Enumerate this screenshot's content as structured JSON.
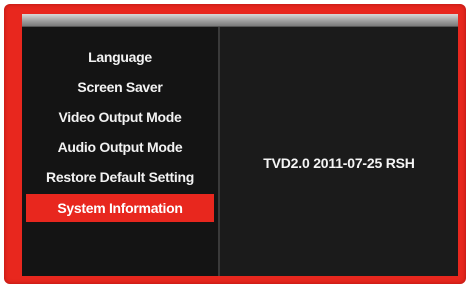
{
  "menu": {
    "items": [
      {
        "label": "Language"
      },
      {
        "label": "Screen Saver"
      },
      {
        "label": "Video Output Mode"
      },
      {
        "label": "Audio Output Mode"
      },
      {
        "label": "Restore Default Setting"
      },
      {
        "label": "System Information",
        "selected": true
      }
    ]
  },
  "info": {
    "version_text": "TVD2.0  2011-07-25 RSH"
  },
  "colors": {
    "frame": "#e8271e",
    "highlight": "#e8271e",
    "panel": "#141414",
    "text": "#f2f2f2"
  }
}
